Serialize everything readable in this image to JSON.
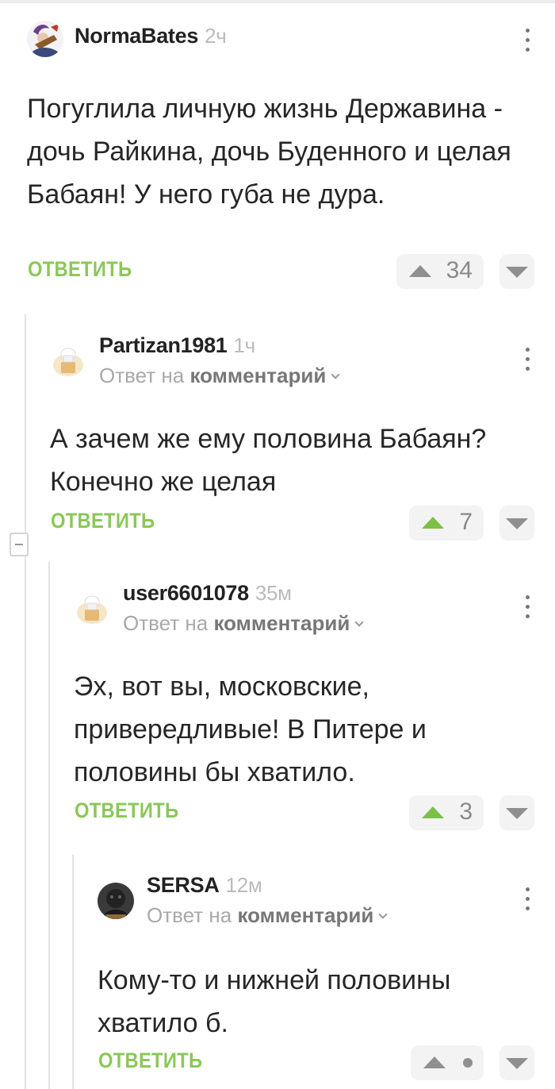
{
  "comments": [
    {
      "username": "NormaBates",
      "time": "2ч",
      "reply_to_prefix": "",
      "reply_to_link": "",
      "text": "Погуглила личную жизнь Державина - дочь Райкина, дочь Буденного и целая Бабаян! У него губа не дура.",
      "reply_label": "ОТВЕТИТЬ",
      "score": "34",
      "upvoted": false
    },
    {
      "username": "Partizan1981",
      "time": "1ч",
      "reply_to_prefix": "Ответ на ",
      "reply_to_link": "комментарий",
      "text": "А зачем же ему половина Бабаян? Конечно же целая",
      "reply_label": "ОТВЕТИТЬ",
      "score": "7",
      "upvoted": true
    },
    {
      "username": "user6601078",
      "time": "35м",
      "reply_to_prefix": "Ответ на ",
      "reply_to_link": "комментарий",
      "text": "Эх, вот вы, московские, привередливые! В Питере и половины бы хватило.",
      "reply_label": "ОТВЕТИТЬ",
      "score": "3",
      "upvoted": true
    },
    {
      "username": "SERSA",
      "time": "12м",
      "reply_to_prefix": "Ответ на ",
      "reply_to_link": "комментарий",
      "text": "Кому-то и нижней половины хватило б.",
      "reply_label": "ОТВЕТИТЬ",
      "score": "",
      "upvoted": false
    }
  ],
  "icons": {
    "upvote": "triangle-up-icon",
    "downvote": "triangle-down-icon",
    "menu": "more-vertical-icon",
    "collapse": "minus-icon"
  },
  "colors": {
    "accent_green": "#8ac858",
    "upvoted_green": "#7cc04a",
    "muted": "#a9a9a9"
  }
}
